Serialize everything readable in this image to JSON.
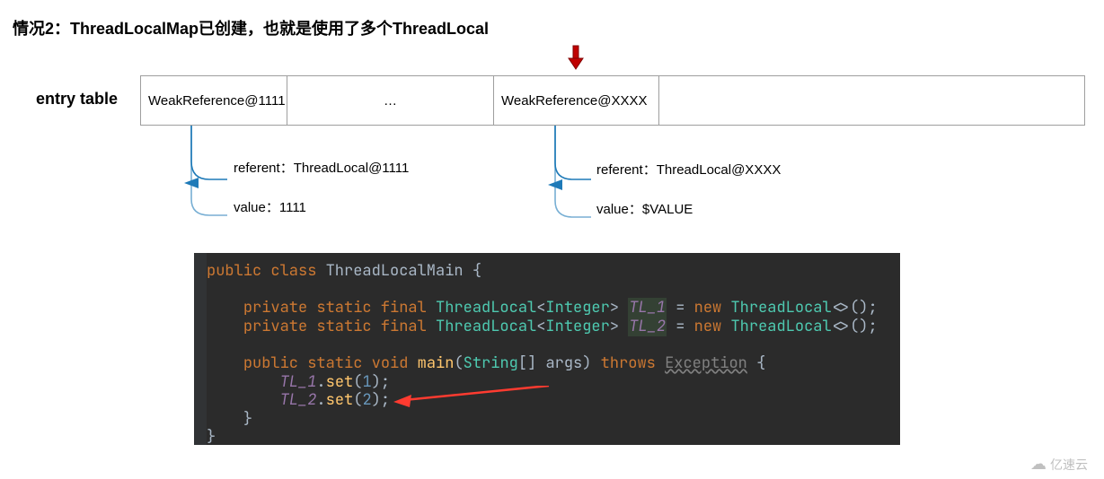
{
  "title": "情况2：ThreadLocalMap已创建，也就是使用了多个ThreadLocal",
  "entry_label": "entry table",
  "table": {
    "cells": [
      "WeakReference@1111",
      "…",
      "WeakReference@XXXX",
      ""
    ]
  },
  "detail_left": {
    "referent": "referent：ThreadLocal@1111",
    "value": "value：1111"
  },
  "detail_right": {
    "referent": "referent：ThreadLocal@XXXX",
    "value": "value：$VALUE"
  },
  "code": {
    "line1_kw": "public class ",
    "line1_cls": "ThreadLocalMain ",
    "line1_tail": "{",
    "line3a_kw": "private static final ",
    "line3a_type": "ThreadLocal",
    "line3a_lt": "<",
    "line3a_gen": "Integer",
    "line3a_gt": "> ",
    "line3a_name": "TL_1",
    "line3a_eq": " = ",
    "line3a_new": "new ",
    "line3a_type2": "ThreadLocal",
    "line3a_tail": "<>();",
    "line3b_name": "TL_2",
    "line5_kw": "public static ",
    "line5_void": "void ",
    "line5_main": "main",
    "line5_open": "(",
    "line5_str": "String",
    "line5_br": "[] ",
    "line5_args": "args",
    "line5_close": ") ",
    "line5_throws": "throws ",
    "line5_exc": "Exception",
    "line5_tail": " {",
    "line6_name": "TL_1",
    "line6_dot": ".",
    "line6_set": "set",
    "line6_open": "(",
    "line6_num": "1",
    "line6_close": ");",
    "line7_name": "TL_2",
    "line7_num": "2",
    "brace": "}"
  },
  "watermark": "亿速云"
}
